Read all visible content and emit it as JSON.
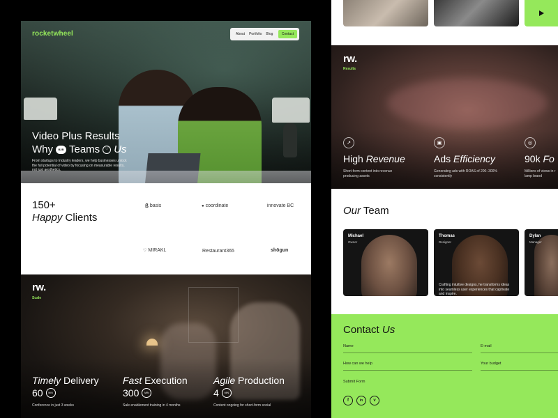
{
  "brand": "rocketwheel",
  "nav": {
    "items": [
      "About",
      "Portfolio",
      "Blog"
    ],
    "contact": "Contact"
  },
  "hero": {
    "title_line1": "Video Plus Results",
    "title_why": "Why",
    "badge_b2b": "B2B",
    "title_teams": "Teams",
    "heart_icon": "♡",
    "title_us": "Us",
    "subtitle": "From startups to Industry leaders, we help businesses unlock the full potential of video by focusing on measurable results, not just aesthetics."
  },
  "clients": {
    "count": "150+",
    "label_italic": "Happy",
    "label_rest": "Clients",
    "logos": [
      "basis",
      "coordinate",
      "innovate BC",
      "MIRAKL",
      "Restaurant365",
      "shōgun"
    ]
  },
  "scale": {
    "logo": "rw.",
    "tag": "Scale",
    "stats": [
      {
        "italic": "Timely",
        "rest": "Delivery",
        "value": "60",
        "unit": "MIN",
        "desc": "Conference in just 3 weeks"
      },
      {
        "italic": "Fast",
        "rest": "Execution",
        "value": "300",
        "unit": "MIN",
        "desc": "Sale enablement training in 4 months"
      },
      {
        "italic": "Agile",
        "rest": "Production",
        "value": "4",
        "unit": "MIN",
        "desc": "Content ongoing for short-form social"
      }
    ]
  },
  "results": {
    "logo": "rw.",
    "tag": "Results",
    "items": [
      {
        "icon": "trend-up-icon",
        "italic": "",
        "bold": "High",
        "rest": "Revenue",
        "desc": "Short-form content into revenue producing assets"
      },
      {
        "icon": "ads-icon",
        "italic": "",
        "bold": "Ads",
        "rest": "Efficiency",
        "desc": "Generating ads with ROAS of 200–300% consistently"
      },
      {
        "icon": "target-icon",
        "italic": "",
        "bold": "90k",
        "rest": "Fo",
        "desc": "Millions of views in r lamp brand"
      }
    ]
  },
  "team": {
    "title_italic": "Our",
    "title_rest": "Team",
    "members": [
      {
        "name": "Michael",
        "role": "Owner",
        "desc": ""
      },
      {
        "name": "Thomas",
        "role": "Designer",
        "desc": "Crafting intuitive designs, he transforms ideas into seamless user experiences that captivate and inspire."
      },
      {
        "name": "Dylan",
        "role": "Manager",
        "desc": ""
      }
    ]
  },
  "contact": {
    "title_rest": "Contact",
    "title_italic": "Us",
    "fields": [
      "Name",
      "E-mail",
      "How can we help",
      "Your budget"
    ],
    "submit": "Submit Form",
    "social": [
      "f",
      "in",
      "v"
    ]
  },
  "colors": {
    "accent": "#95e85b",
    "dark": "#111111",
    "light": "#ffffff"
  }
}
